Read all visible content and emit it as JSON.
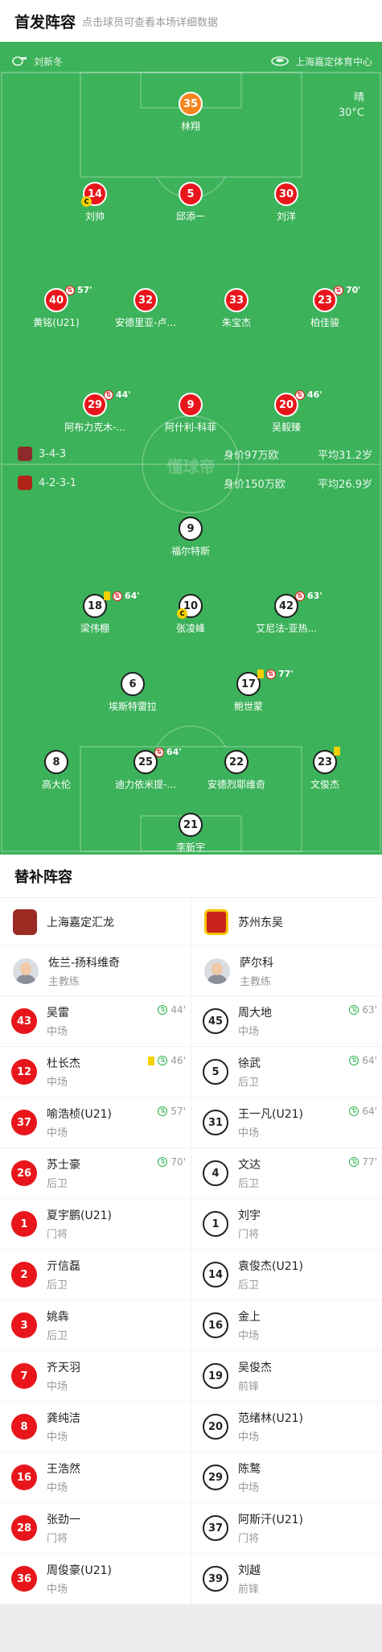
{
  "header": {
    "title": "首发阵容",
    "subtitle": "点击球员可查看本场详细数据"
  },
  "pitch": {
    "referee": "刘新冬",
    "stadium": "上海嘉定体育中心",
    "weather": "晴",
    "temperature": "30°C",
    "watermark": "懂球帝",
    "home": {
      "formation": "3-4-3",
      "value": "身价97万欧",
      "avg_age": "平均31.2岁"
    },
    "away": {
      "formation": "4-2-3-1",
      "value": "身价150万欧",
      "avg_age": "平均26.9岁"
    },
    "home_players": [
      {
        "num": "35",
        "name": "林翔",
        "gk": true
      },
      {
        "num": "14",
        "name": "刘帅",
        "captain": "C"
      },
      {
        "num": "5",
        "name": "邱添一"
      },
      {
        "num": "30",
        "name": "刘洋"
      },
      {
        "num": "40",
        "name": "黄铭(U21)",
        "sub": "57'"
      },
      {
        "num": "32",
        "name": "安德里亚-卢..."
      },
      {
        "num": "33",
        "name": "朱宝杰"
      },
      {
        "num": "23",
        "name": "柏佳骏",
        "sub": "70'"
      },
      {
        "num": "29",
        "name": "阿布力克木-...",
        "sub": "44'"
      },
      {
        "num": "9",
        "name": "阿什利-科菲"
      },
      {
        "num": "20",
        "name": "吴毅臻",
        "sub": "46'"
      }
    ],
    "away_players": [
      {
        "num": "9",
        "name": "福尔特斯"
      },
      {
        "num": "18",
        "name": "梁伟棚",
        "sub": "64'",
        "yellow": true
      },
      {
        "num": "10",
        "name": "张凌峰",
        "captain": "C"
      },
      {
        "num": "42",
        "name": "艾尼法-亚热...",
        "sub": "63'"
      },
      {
        "num": "6",
        "name": "埃斯特雷拉"
      },
      {
        "num": "17",
        "name": "鲍世蒙",
        "sub": "77'",
        "yellow": true
      },
      {
        "num": "8",
        "name": "高大伦"
      },
      {
        "num": "25",
        "name": "迪力依米提-...",
        "sub": "64'"
      },
      {
        "num": "22",
        "name": "安德烈耶维奇"
      },
      {
        "num": "23",
        "name": "文俊杰",
        "yellow": true
      },
      {
        "num": "21",
        "name": "李新宇",
        "gk": true
      }
    ]
  },
  "subs": {
    "title": "替补阵容",
    "home": {
      "team": "上海嘉定汇龙",
      "coach": {
        "name": "佐兰-扬科维奇",
        "role": "主教练"
      },
      "players": [
        {
          "num": "43",
          "name": "吴雷",
          "pos": "中场",
          "in": "44'"
        },
        {
          "num": "12",
          "name": "杜长杰",
          "pos": "中场",
          "in": "46'",
          "yellow": true
        },
        {
          "num": "37",
          "name": "喻浩桢(U21)",
          "pos": "中场",
          "in": "57'"
        },
        {
          "num": "26",
          "name": "苏士豪",
          "pos": "后卫",
          "in": "70'"
        },
        {
          "num": "1",
          "name": "夏宇鹏(U21)",
          "pos": "门将"
        },
        {
          "num": "2",
          "name": "亓信磊",
          "pos": "后卫"
        },
        {
          "num": "3",
          "name": "姚犇",
          "pos": "后卫"
        },
        {
          "num": "7",
          "name": "齐天羽",
          "pos": "中场"
        },
        {
          "num": "8",
          "name": "龚纯洁",
          "pos": "中场"
        },
        {
          "num": "16",
          "name": "王浩然",
          "pos": "中场"
        },
        {
          "num": "28",
          "name": "张劲一",
          "pos": "门将"
        },
        {
          "num": "36",
          "name": "周俊豪(U21)",
          "pos": "中场"
        }
      ]
    },
    "away": {
      "team": "苏州东吴",
      "coach": {
        "name": "萨尔科",
        "role": "主教练"
      },
      "players": [
        {
          "num": "45",
          "name": "周大地",
          "pos": "中场",
          "in": "63'"
        },
        {
          "num": "5",
          "name": "徐武",
          "pos": "后卫",
          "in": "64'"
        },
        {
          "num": "31",
          "name": "王一凡(U21)",
          "pos": "中场",
          "in": "64'"
        },
        {
          "num": "4",
          "name": "文达",
          "pos": "后卫",
          "in": "77'"
        },
        {
          "num": "1",
          "name": "刘宇",
          "pos": "门将"
        },
        {
          "num": "14",
          "name": "袁俊杰(U21)",
          "pos": "后卫"
        },
        {
          "num": "16",
          "name": "金上",
          "pos": "中场"
        },
        {
          "num": "19",
          "name": "吴俊杰",
          "pos": "前锋"
        },
        {
          "num": "20",
          "name": "范绪林(U21)",
          "pos": "中场"
        },
        {
          "num": "29",
          "name": "陈鹜",
          "pos": "中场"
        },
        {
          "num": "37",
          "name": "阿斯汗(U21)",
          "pos": "门将"
        },
        {
          "num": "39",
          "name": "刘越",
          "pos": "前锋"
        }
      ]
    }
  },
  "colors": {
    "pitch": "#3cb25a",
    "home": "#e8161b",
    "home_gk": "#f5861f",
    "away": "#ffffff",
    "sub_in": "#2bb24c",
    "yellow_card": "#f5d000"
  }
}
